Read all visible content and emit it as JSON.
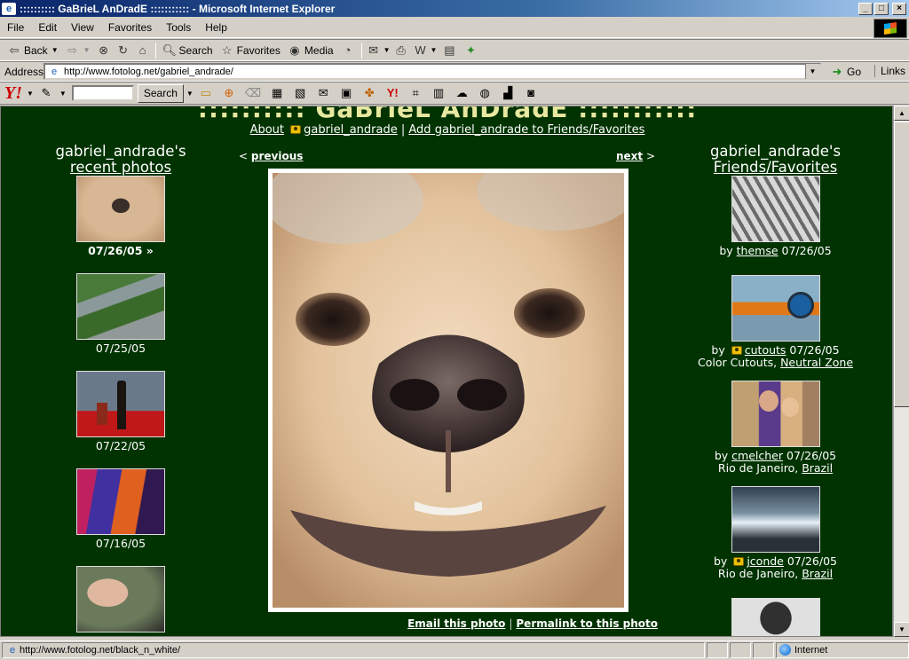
{
  "window": {
    "title": ":::::::::: GaBrieL AnDradE ::::::::::: - Microsoft Internet Explorer",
    "min": "_",
    "max": "□",
    "close": "×"
  },
  "menu": [
    "File",
    "Edit",
    "View",
    "Favorites",
    "Tools",
    "Help"
  ],
  "toolbar": {
    "back": "Back",
    "search": "Search",
    "favorites": "Favorites",
    "media": "Media"
  },
  "address": {
    "label": "Address",
    "url": "http://www.fotolog.net/gabriel_andrade/",
    "go": "Go",
    "links": "Links"
  },
  "yahoo": {
    "logo": "Y!",
    "search_label": "Search"
  },
  "site": {
    "title": ":::::::::: GaBrieL AnDradE :::::::::::",
    "about": "About",
    "user": "gabriel_andrade",
    "add_link": "Add gabriel_andrade to Friends/Favorites"
  },
  "left": {
    "head1": "gabriel_andrade's",
    "head2": "recent photos",
    "photos": [
      {
        "date": "07/26/05 »"
      },
      {
        "date": "07/25/05"
      },
      {
        "date": "07/22/05"
      },
      {
        "date": "07/16/05"
      },
      {
        "date": ""
      }
    ]
  },
  "center": {
    "prev_arrow": "<",
    "previous": "previous",
    "next": "next",
    "next_arrow": ">",
    "email": "Email this photo",
    "permalink": "Permalink to this photo"
  },
  "right": {
    "head1": "gabriel_andrade's",
    "head2": "Friends/Favorites",
    "friends": [
      {
        "by": "by",
        "user": "themse",
        "date": "07/26/05",
        "line2": "",
        "link2": ""
      },
      {
        "by": "by",
        "user": "cutouts",
        "date": "07/26/05",
        "line2": "Color Cutouts,",
        "link2": "Neutral Zone"
      },
      {
        "by": "by",
        "user": "cmelcher",
        "date": "07/26/05",
        "line2": "Rio de Janeiro,",
        "link2": "Brazil"
      },
      {
        "by": "by",
        "user": "jconde",
        "date": "07/26/05",
        "line2": "Rio de Janeiro,",
        "link2": "Brazil"
      }
    ]
  },
  "status": {
    "text": "http://www.fotolog.net/black_n_white/",
    "zone": "Internet"
  }
}
